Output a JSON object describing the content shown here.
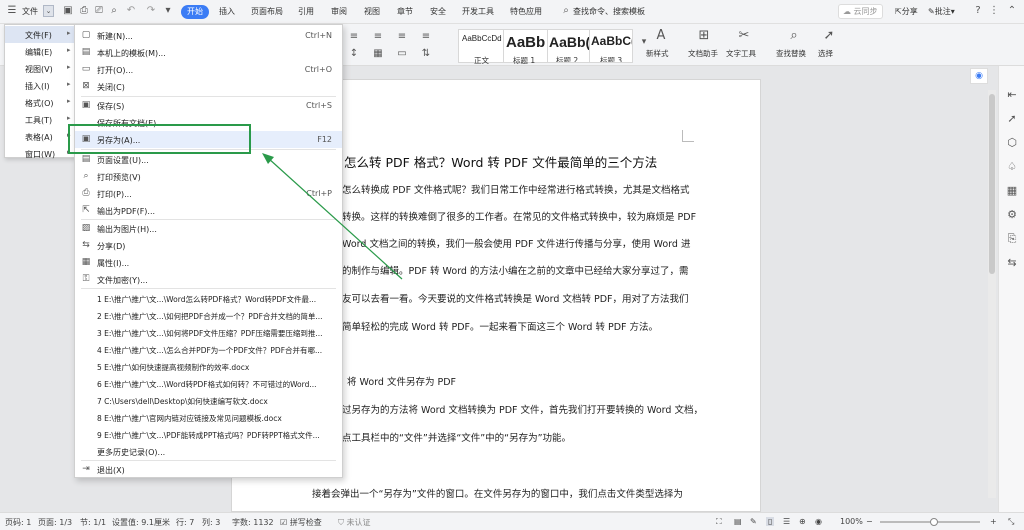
{
  "topbar": {
    "file_menu": "文件",
    "tabs": [
      "开始",
      "插入",
      "页面布局",
      "引用",
      "审阅",
      "视图",
      "章节",
      "安全",
      "开发工具",
      "特色应用"
    ],
    "search": "查找命令、搜索模板",
    "cloud": "云同步",
    "share": "分享",
    "annotate": "批注"
  },
  "ribbon": {
    "styles": [
      {
        "sample": "AaBbCcDd",
        "label": "正文"
      },
      {
        "sample": "AaBb",
        "label": "标题 1"
      },
      {
        "sample": "AaBb(",
        "label": "标题 2"
      },
      {
        "sample": "AaBbC(",
        "label": "标题 3"
      }
    ],
    "new_style": "新样式",
    "doc_assistant": "文档助手",
    "text_tools": "文字工具",
    "find_replace": "查找替换",
    "select": "选择"
  },
  "left_menu": [
    {
      "label": "文件(F)"
    },
    {
      "label": "编辑(E)"
    },
    {
      "label": "视图(V)"
    },
    {
      "label": "插入(I)"
    },
    {
      "label": "格式(O)"
    },
    {
      "label": "工具(T)"
    },
    {
      "label": "表格(A)"
    },
    {
      "label": "窗口(W)"
    }
  ],
  "file_menu": {
    "items": [
      {
        "label": "新建(N)...",
        "shortcut": "Ctrl+N",
        "icon": "new-doc-icon"
      },
      {
        "label": "本机上的模板(M)...",
        "shortcut": "",
        "icon": "template-icon"
      },
      {
        "label": "打开(O)...",
        "shortcut": "Ctrl+O",
        "icon": "open-folder-icon"
      },
      {
        "label": "关闭(C)",
        "shortcut": "",
        "icon": "close-doc-icon"
      },
      {
        "label": "保存(S)",
        "shortcut": "Ctrl+S",
        "icon": "save-icon"
      },
      {
        "label": "保存所有文档(E)",
        "shortcut": "",
        "icon": ""
      },
      {
        "label": "另存为(A)...",
        "shortcut": "F12",
        "icon": "save-as-icon"
      },
      {
        "label": "页面设置(U)...",
        "shortcut": "",
        "icon": "page-setup-icon"
      },
      {
        "label": "打印预览(V)",
        "shortcut": "",
        "icon": "print-preview-icon"
      },
      {
        "label": "打印(P)...",
        "shortcut": "Ctrl+P",
        "icon": "print-icon"
      },
      {
        "label": "输出为PDF(F)...",
        "shortcut": "",
        "icon": "pdf-icon"
      },
      {
        "label": "输出为图片(H)...",
        "shortcut": "",
        "icon": "image-export-icon"
      },
      {
        "label": "分享(D)",
        "shortcut": "",
        "icon": "share-icon"
      },
      {
        "label": "属性(I)...",
        "shortcut": "",
        "icon": "properties-icon"
      },
      {
        "label": "文件加密(Y)...",
        "shortcut": "",
        "icon": "encrypt-icon"
      }
    ],
    "recent": [
      "1 E:\\推广\\推广\\文...\\Word怎么转PDF格式？Word转PDF文件最...",
      "2 E:\\推广\\推广\\文...\\如何把PDF合并成一个？PDF合并文档的简单...",
      "3 E:\\推广\\推广\\文...\\如何将PDF文件压缩？PDF压缩需要压缩到推...",
      "4 E:\\推广\\推广\\文...\\怎么合并PDF为一个PDF文件？PDF合并有哪...",
      "5 E:\\推广\\如何快速提高视频制作的效率.docx",
      "6 E:\\推广\\推广\\文...\\Word转PDF格式如何转？不可错过的Word...",
      "7 C:\\Users\\dell\\Desktop\\如何快速编写软文.docx",
      "8 E:\\推广\\推广\\官网内链对应链接及常见问题模板.docx",
      "9 E:\\推广\\推广\\文...\\PDF能转成PPT格式吗？PDF转PPT格式文件..."
    ],
    "more_history": "更多历史记录(O)...",
    "exit": "退出(X)"
  },
  "document": {
    "title": "怎么转 PDF 格式？Word 转 PDF 文件最简单的三个方法",
    "lines": [
      "怎么转换成 PDF 文件格式呢？我们日常工作中经常进行格式转换，尤其是文档格式",
      "转换。这样的转换难倒了很多的工作者。在常见的文件格式转换中，较为麻烦是 PDF",
      "Word 文档之间的转换，我们一般会使用 PDF 文件进行传播与分享，使用 Word 进",
      "的制作与编辑。PDF 转 Word 的方法小编在之前的文章中已经给大家分享过了，需",
      "友可以去看一看。今天要说的文件格式转换是 Word 文档转 PDF，用对了方法我们",
      "简单轻松的完成 Word 转 PDF。一起来看下面这三个 Word 转 PDF 方法。"
    ],
    "section_heading": "将 Word 文件另存为 PDF",
    "section_lines": [
      "过另存为的方法将 Word 文档转换为 PDF 文件，首先我们打开要转换的 Word 文档，",
      "点工具栏中的“文件”并选择“文件”中的“另存为”功能。"
    ],
    "last_line": "接着会弹出一个“另存为”文件的窗口。在文件另存为的窗口中，我们点击文件类型选择为"
  },
  "statusbar": {
    "page_no": "页码: 1",
    "pages": "页面: 1/3",
    "section": "节: 1/1",
    "set_value": "设置值: 9.1厘米",
    "row": "行: 7",
    "col": "列: 3",
    "words": "字数: 1132",
    "spell": "拼写检查",
    "cert": "未认证",
    "zoom": "100%"
  },
  "colors": {
    "accent": "#3b7cf5",
    "highlight": "#2a9a4a"
  }
}
